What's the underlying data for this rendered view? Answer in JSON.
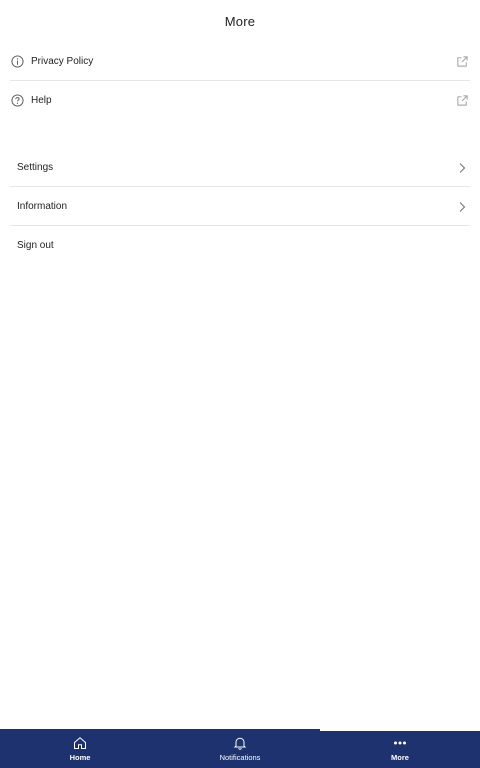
{
  "header": {
    "title": "More"
  },
  "links": [
    {
      "label": "Privacy Policy",
      "icon": "info-icon",
      "trail_icon": "external-link-icon"
    },
    {
      "label": "Help",
      "icon": "help-circle-icon",
      "trail_icon": "external-link-icon"
    }
  ],
  "settings": [
    {
      "label": "Settings",
      "trail_icon": "chevron-right-icon"
    },
    {
      "label": "Information",
      "trail_icon": "chevron-right-icon"
    },
    {
      "label": "Sign out"
    }
  ],
  "tabbar": {
    "background": "#1e326f",
    "active_index": 2,
    "tabs": [
      {
        "label": "Home",
        "icon": "home-icon"
      },
      {
        "label": "Notifications",
        "icon": "bell-icon"
      },
      {
        "label": "More",
        "icon": "more-horizontal-icon"
      }
    ]
  }
}
